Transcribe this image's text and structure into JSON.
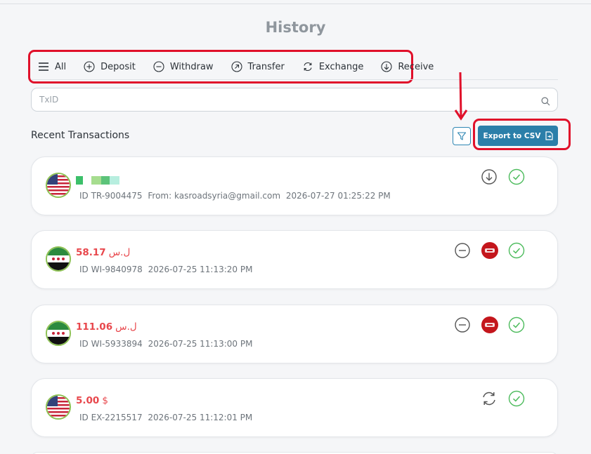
{
  "page": {
    "title": "History"
  },
  "tabs": [
    {
      "label": "All",
      "icon": "list-icon",
      "active": true
    },
    {
      "label": "Deposit",
      "icon": "plus-circle-icon"
    },
    {
      "label": "Withdraw",
      "icon": "minus-circle-icon"
    },
    {
      "label": "Transfer",
      "icon": "arrow-up-right-circle-icon"
    },
    {
      "label": "Exchange",
      "icon": "refresh-icon"
    },
    {
      "label": "Receive",
      "icon": "arrow-down-circle-icon"
    }
  ],
  "search": {
    "placeholder": "TxID",
    "value": ""
  },
  "section": {
    "title": "Recent Transactions"
  },
  "export": {
    "label": "Export to CSV",
    "icon": "file-export-icon"
  },
  "colors": {
    "accent": "#2b7fa9",
    "amount": "#e8474c",
    "success": "#4cbb5c",
    "highlight": "#e0102a"
  },
  "transactions": [
    {
      "flag": "us-flag",
      "amount": "",
      "currency": "",
      "id_label": "ID TR-9004475",
      "from": "From: kasroadsyria@gmail.com",
      "datetime": "2026-07-27 01:25:22 PM",
      "type_icon": "arrow-down-circle-icon",
      "status_icon": "check-circle-icon"
    },
    {
      "flag": "syria-flag",
      "amount": "58.17",
      "currency": "ل.س",
      "id_label": "ID WI-9840978",
      "datetime": "2026-07-25 11:13:20 PM",
      "type_icon": "minus-circle-icon",
      "wallet_icon": "wallet-logo-icon",
      "status_icon": "check-circle-icon"
    },
    {
      "flag": "syria-flag",
      "amount": "111.06",
      "currency": "ل.س",
      "id_label": "ID WI-5933894",
      "datetime": "2026-07-25 11:13:00 PM",
      "type_icon": "minus-circle-icon",
      "wallet_icon": "wallet-logo-icon",
      "status_icon": "check-circle-icon"
    },
    {
      "flag": "us-flag",
      "amount": "5.00",
      "currency": "$",
      "id_label": "ID EX-2215517",
      "datetime": "2026-07-25 11:12:01 PM",
      "type_icon": "refresh-icon",
      "status_icon": "check-circle-icon"
    }
  ]
}
